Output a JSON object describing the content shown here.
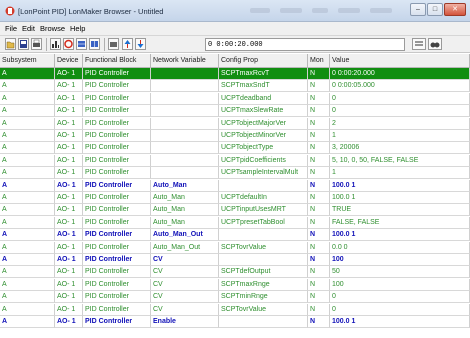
{
  "window": {
    "title": "[LonPoint PID] LonMaker Browser - Untitled",
    "close_label": "✕",
    "minimize_label": "–",
    "maximize_label": "□"
  },
  "menu": [
    "File",
    "Edit",
    "Browse",
    "Help"
  ],
  "toolbar": {
    "address_value": "0 0:00:20.000"
  },
  "columns": [
    "Subsystem",
    "Device",
    "Functional Block",
    "Network Variable",
    "Config Prop",
    "Mon",
    "Value"
  ],
  "rows": [
    {
      "cells": [
        "A",
        "AO- 1",
        "PID Controller",
        "",
        "SCPTmaxRcvT",
        "N",
        "0 0:00:20.000"
      ],
      "selected": true,
      "parent": false
    },
    {
      "cells": [
        "A",
        "AO- 1",
        "PID Controller",
        "",
        "SCPTmaxSndT",
        "N",
        "0 0:00:05.000"
      ],
      "selected": false,
      "parent": false
    },
    {
      "cells": [
        "A",
        "AO- 1",
        "PID Controller",
        "",
        "UCPTdeadband",
        "N",
        "0"
      ],
      "selected": false,
      "parent": false
    },
    {
      "cells": [
        "A",
        "AO- 1",
        "PID Controller",
        "",
        "UCPTmaxSlewRate",
        "N",
        "0"
      ],
      "selected": false,
      "parent": false
    },
    {
      "cells": [
        "A",
        "AO- 1",
        "PID Controller",
        "",
        "UCPTobjectMajorVer",
        "N",
        "2"
      ],
      "selected": false,
      "parent": false
    },
    {
      "cells": [
        "A",
        "AO- 1",
        "PID Controller",
        "",
        "UCPTobjectMinorVer",
        "N",
        "1"
      ],
      "selected": false,
      "parent": false
    },
    {
      "cells": [
        "A",
        "AO- 1",
        "PID Controller",
        "",
        "UCPTobjectType",
        "N",
        "3, 20006"
      ],
      "selected": false,
      "parent": false
    },
    {
      "cells": [
        "A",
        "AO- 1",
        "PID Controller",
        "",
        "UCPTpidCoefficients",
        "N",
        "5, 10, 0, 50, FALSE, FALSE"
      ],
      "selected": false,
      "parent": false
    },
    {
      "cells": [
        "A",
        "AO- 1",
        "PID Controller",
        "",
        "UCPTsampleIntervalMult",
        "N",
        "1"
      ],
      "selected": false,
      "parent": false
    },
    {
      "cells": [
        "A",
        "AO- 1",
        "PID Controller",
        "Auto_Man",
        "",
        "N",
        "100.0 1"
      ],
      "selected": false,
      "parent": true
    },
    {
      "cells": [
        "A",
        "AO- 1",
        "PID Controller",
        "Auto_Man",
        "UCPTdefaultIn",
        "N",
        "100.0 1"
      ],
      "selected": false,
      "parent": false
    },
    {
      "cells": [
        "A",
        "AO- 1",
        "PID Controller",
        "Auto_Man",
        "UCPTinputUsesMRT",
        "N",
        "TRUE"
      ],
      "selected": false,
      "parent": false
    },
    {
      "cells": [
        "A",
        "AO- 1",
        "PID Controller",
        "Auto_Man",
        "UCPTpresetTabBool",
        "N",
        "FALSE, FALSE"
      ],
      "selected": false,
      "parent": false
    },
    {
      "cells": [
        "A",
        "AO- 1",
        "PID Controller",
        "Auto_Man_Out",
        "",
        "N",
        "100.0 1"
      ],
      "selected": false,
      "parent": true
    },
    {
      "cells": [
        "A",
        "AO- 1",
        "PID Controller",
        "Auto_Man_Out",
        "SCPTovrValue",
        "N",
        "0.0 0"
      ],
      "selected": false,
      "parent": false
    },
    {
      "cells": [
        "A",
        "AO- 1",
        "PID Controller",
        "CV",
        "",
        "N",
        "100"
      ],
      "selected": false,
      "parent": true
    },
    {
      "cells": [
        "A",
        "AO- 1",
        "PID Controller",
        "CV",
        "SCPTdefOutput",
        "N",
        "50"
      ],
      "selected": false,
      "parent": false
    },
    {
      "cells": [
        "A",
        "AO- 1",
        "PID Controller",
        "CV",
        "SCPTmaxRnge",
        "N",
        "100"
      ],
      "selected": false,
      "parent": false
    },
    {
      "cells": [
        "A",
        "AO- 1",
        "PID Controller",
        "CV",
        "SCPTminRnge",
        "N",
        "0"
      ],
      "selected": false,
      "parent": false
    },
    {
      "cells": [
        "A",
        "AO- 1",
        "PID Controller",
        "CV",
        "SCPTovrValue",
        "N",
        "0"
      ],
      "selected": false,
      "parent": false
    },
    {
      "cells": [
        "A",
        "AO- 1",
        "PID Controller",
        "Enable",
        "",
        "N",
        "100.0 1"
      ],
      "selected": false,
      "parent": true
    }
  ],
  "colors": {
    "selected_row": "#118e11",
    "child_text": "#2f8f2f",
    "parent_text": "#1212b8"
  }
}
